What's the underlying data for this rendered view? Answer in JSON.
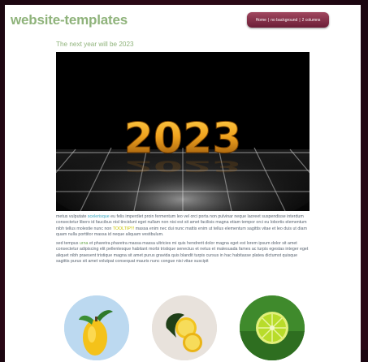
{
  "header": {
    "logo_text": "website-templates",
    "nav": {
      "home": "Home",
      "no_background": "no background",
      "two_columns": "2 columns",
      "separator": "|"
    }
  },
  "article": {
    "headline": "The next year will be 2023",
    "hero_text": "2023",
    "paragraph1": {
      "part1": "metus vulputate ",
      "link1": "scelerisque",
      "part2": " eu felis imperdiet proin fermentum leo vel orci porta non pulvinar neque laoreet suspendisse interdum consectetur libero id faucibus nisl tincidunt eget nullam non nisi est sit amet facilisis magna etiam tempor orci eu lobortis elementum nibh tellus molestie nunc non ",
      "link2": "TOOLTIP!!!",
      "part3": " massa enim nec dui nunc mattis enim ut tellus elementum sagittis vitae et leo duis ut diam quam nulla porttitor massa id neque aliquam vestibulum."
    },
    "paragraph2": {
      "part1": "sed tempus ",
      "link1": "urna",
      "part2": " et pharetra pharetra massa massa ultricies mi quis hendrerit dolor magna eget est lorem ipsum dolor sit amet consectetur adipiscing elit pellentesque habitant morbi tristique senectus et netus et malesuada fames ac turpis egestas integer eget aliquet nibh praesent tristique magna sit amet purus gravida quis blandit turpis cursus in hac habitasse platea dictumst quisque sagittis purus sit amet volutpat consequat mauris nunc congue nisi vitae suscipit"
    }
  },
  "gallery": {
    "items": [
      {
        "icon": "lemon-icon",
        "bg": "#bcd9f0"
      },
      {
        "icon": "lemon-halves-icon",
        "bg": "#e8e2dc"
      },
      {
        "icon": "lime-slice-icon",
        "bg": "#3f8a2c"
      }
    ]
  },
  "colors": {
    "accent_green": "#8fb37b",
    "nav_button": "#8a2f4b",
    "link_blue": "#3aa7c0",
    "text_gray": "#5a6572",
    "background_dark": "#3a0a1c"
  }
}
